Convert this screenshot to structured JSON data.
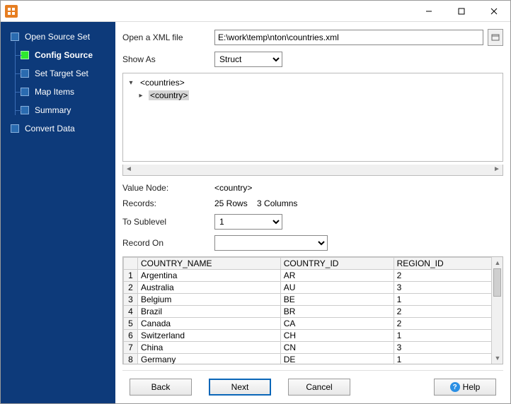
{
  "sidebar": {
    "top1": "Open Source Set",
    "subs": [
      {
        "label": "Config Source",
        "active": true
      },
      {
        "label": "Set Target Set",
        "active": false
      },
      {
        "label": "Map Items",
        "active": false
      },
      {
        "label": "Summary",
        "active": false
      }
    ],
    "top2": "Convert Data"
  },
  "form": {
    "open_label": "Open a XML file",
    "open_value": "E:\\work\\temp\\nton\\countries.xml",
    "show_as_label": "Show As",
    "show_as_value": "Struct",
    "value_node_label": "Value Node:",
    "value_node_value": "<country>",
    "records_label": "Records:",
    "records_value": "25 Rows    3 Columns",
    "to_sublevel_label": "To Sublevel",
    "to_sublevel_value": "1",
    "record_on_label": "Record On",
    "record_on_value": ""
  },
  "tree": {
    "root": "<countries>",
    "child": "<country>"
  },
  "table": {
    "columns": [
      "COUNTRY_NAME",
      "COUNTRY_ID",
      "REGION_ID"
    ],
    "rows": [
      [
        "Argentina",
        "AR",
        "2"
      ],
      [
        "Australia",
        "AU",
        "3"
      ],
      [
        "Belgium",
        "BE",
        "1"
      ],
      [
        "Brazil",
        "BR",
        "2"
      ],
      [
        "Canada",
        "CA",
        "2"
      ],
      [
        "Switzerland",
        "CH",
        "1"
      ],
      [
        "China",
        "CN",
        "3"
      ],
      [
        "Germany",
        "DE",
        "1"
      ]
    ]
  },
  "footer": {
    "back": "Back",
    "next": "Next",
    "cancel": "Cancel",
    "help": "Help"
  }
}
